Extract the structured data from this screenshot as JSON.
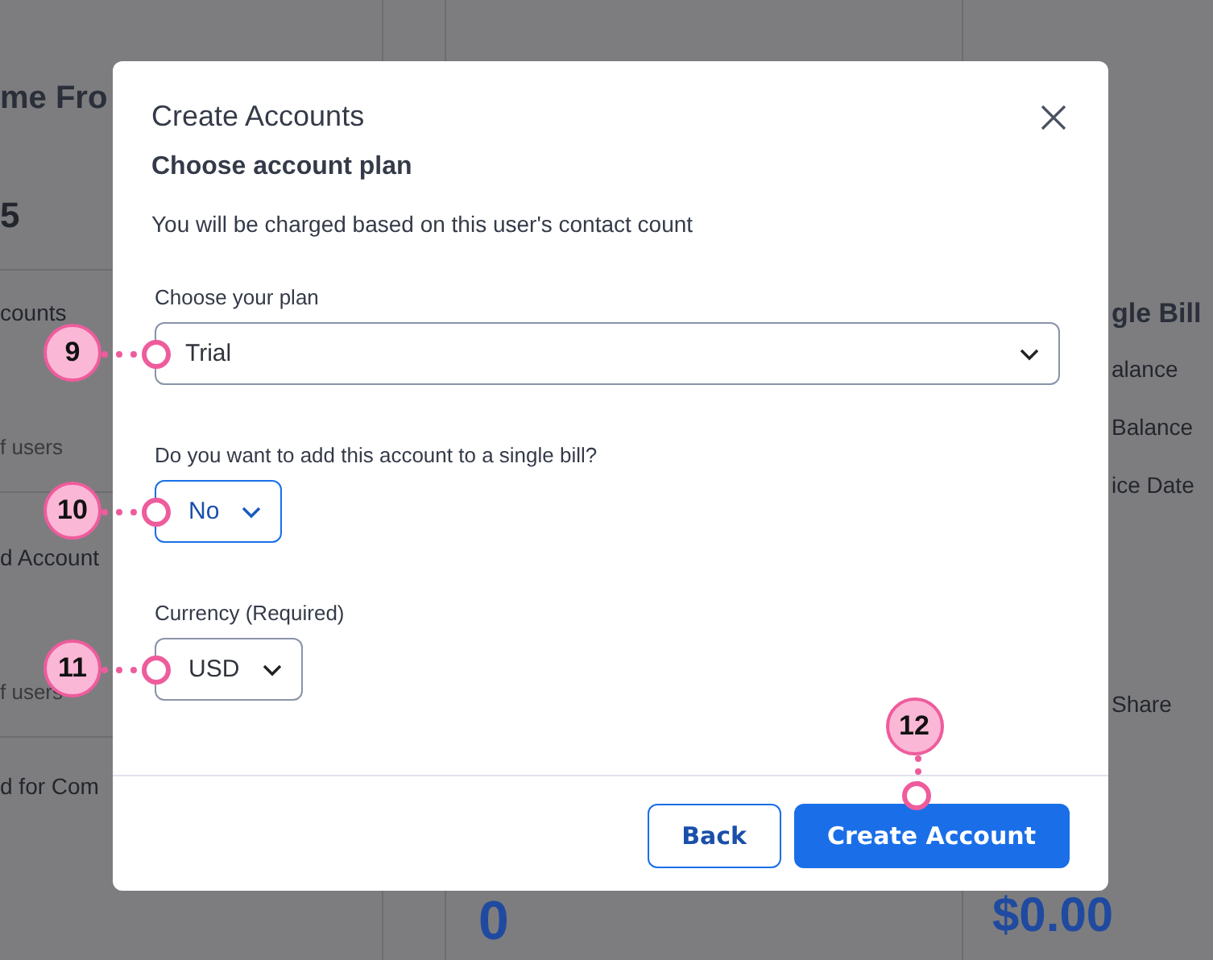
{
  "background": {
    "left": [
      {
        "kind": "heading",
        "text": "me Fro"
      },
      {
        "kind": "stat",
        "text": "5"
      },
      {
        "kind": "label",
        "text": "counts"
      },
      {
        "kind": "note",
        "text": "f users"
      },
      {
        "kind": "label",
        "text": "d Account"
      },
      {
        "kind": "note",
        "text": "f users"
      },
      {
        "kind": "label",
        "text": "d for Com"
      }
    ],
    "middle": {
      "value": "0"
    },
    "right": [
      {
        "kind": "heading",
        "text": "gle Bill"
      },
      {
        "kind": "label",
        "text": "alance"
      },
      {
        "kind": "label",
        "text": "Balance"
      },
      {
        "kind": "label",
        "text": "ice Date"
      },
      {
        "kind": "label",
        "text": "Share"
      },
      {
        "kind": "amount",
        "text": "$0.00"
      }
    ]
  },
  "dialog": {
    "title": "Create Accounts",
    "subtitle": "Choose account plan",
    "description": "You will be charged based on this user's contact count",
    "fields": [
      {
        "label": "Choose your plan",
        "value": "Trial",
        "focused": false,
        "wide": true,
        "callout": "9"
      },
      {
        "label": "Do you want to add this account to a single bill?",
        "value": "No",
        "focused": true,
        "wide": false,
        "callout": "10"
      },
      {
        "label": "Currency  (Required)",
        "value": "USD",
        "focused": false,
        "wide": false,
        "callout": "11"
      }
    ],
    "buttons": [
      {
        "label": "Back",
        "kind": "secondary"
      },
      {
        "label": "Create Account",
        "kind": "primary",
        "callout": "12"
      }
    ]
  }
}
